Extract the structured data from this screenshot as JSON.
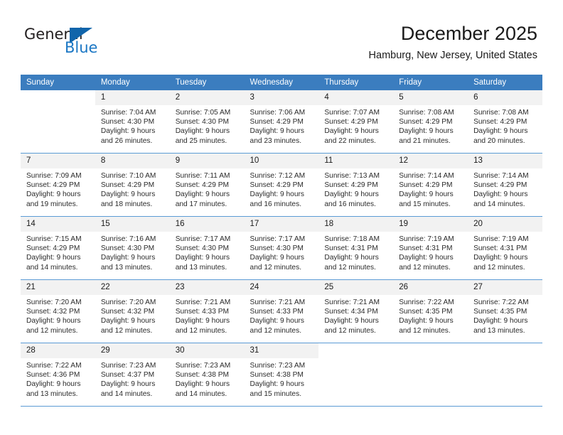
{
  "brand": {
    "name_part1": "General",
    "name_part2": "Blue",
    "triangle_icon": "triangle-icon",
    "accent_color": "#1165ab",
    "blue_text_color": "#1b77c4"
  },
  "header": {
    "title": "December 2025",
    "subtitle": "Hamburg, New Jersey, United States"
  },
  "calendar": {
    "header_bg": "#3b7dbf",
    "header_text_color": "#ffffff",
    "daynum_bg": "#f2f2f2",
    "row_separator_color": "#5b9bd5",
    "weekday_headers": [
      "Sunday",
      "Monday",
      "Tuesday",
      "Wednesday",
      "Thursday",
      "Friday",
      "Saturday"
    ],
    "weeks": [
      [
        {
          "day": "",
          "lines": []
        },
        {
          "day": "1",
          "lines": [
            "Sunrise: 7:04 AM",
            "Sunset: 4:30 PM",
            "Daylight: 9 hours",
            "and 26 minutes."
          ]
        },
        {
          "day": "2",
          "lines": [
            "Sunrise: 7:05 AM",
            "Sunset: 4:30 PM",
            "Daylight: 9 hours",
            "and 25 minutes."
          ]
        },
        {
          "day": "3",
          "lines": [
            "Sunrise: 7:06 AM",
            "Sunset: 4:29 PM",
            "Daylight: 9 hours",
            "and 23 minutes."
          ]
        },
        {
          "day": "4",
          "lines": [
            "Sunrise: 7:07 AM",
            "Sunset: 4:29 PM",
            "Daylight: 9 hours",
            "and 22 minutes."
          ]
        },
        {
          "day": "5",
          "lines": [
            "Sunrise: 7:08 AM",
            "Sunset: 4:29 PM",
            "Daylight: 9 hours",
            "and 21 minutes."
          ]
        },
        {
          "day": "6",
          "lines": [
            "Sunrise: 7:08 AM",
            "Sunset: 4:29 PM",
            "Daylight: 9 hours",
            "and 20 minutes."
          ]
        }
      ],
      [
        {
          "day": "7",
          "lines": [
            "Sunrise: 7:09 AM",
            "Sunset: 4:29 PM",
            "Daylight: 9 hours",
            "and 19 minutes."
          ]
        },
        {
          "day": "8",
          "lines": [
            "Sunrise: 7:10 AM",
            "Sunset: 4:29 PM",
            "Daylight: 9 hours",
            "and 18 minutes."
          ]
        },
        {
          "day": "9",
          "lines": [
            "Sunrise: 7:11 AM",
            "Sunset: 4:29 PM",
            "Daylight: 9 hours",
            "and 17 minutes."
          ]
        },
        {
          "day": "10",
          "lines": [
            "Sunrise: 7:12 AM",
            "Sunset: 4:29 PM",
            "Daylight: 9 hours",
            "and 16 minutes."
          ]
        },
        {
          "day": "11",
          "lines": [
            "Sunrise: 7:13 AM",
            "Sunset: 4:29 PM",
            "Daylight: 9 hours",
            "and 16 minutes."
          ]
        },
        {
          "day": "12",
          "lines": [
            "Sunrise: 7:14 AM",
            "Sunset: 4:29 PM",
            "Daylight: 9 hours",
            "and 15 minutes."
          ]
        },
        {
          "day": "13",
          "lines": [
            "Sunrise: 7:14 AM",
            "Sunset: 4:29 PM",
            "Daylight: 9 hours",
            "and 14 minutes."
          ]
        }
      ],
      [
        {
          "day": "14",
          "lines": [
            "Sunrise: 7:15 AM",
            "Sunset: 4:29 PM",
            "Daylight: 9 hours",
            "and 14 minutes."
          ]
        },
        {
          "day": "15",
          "lines": [
            "Sunrise: 7:16 AM",
            "Sunset: 4:30 PM",
            "Daylight: 9 hours",
            "and 13 minutes."
          ]
        },
        {
          "day": "16",
          "lines": [
            "Sunrise: 7:17 AM",
            "Sunset: 4:30 PM",
            "Daylight: 9 hours",
            "and 13 minutes."
          ]
        },
        {
          "day": "17",
          "lines": [
            "Sunrise: 7:17 AM",
            "Sunset: 4:30 PM",
            "Daylight: 9 hours",
            "and 12 minutes."
          ]
        },
        {
          "day": "18",
          "lines": [
            "Sunrise: 7:18 AM",
            "Sunset: 4:31 PM",
            "Daylight: 9 hours",
            "and 12 minutes."
          ]
        },
        {
          "day": "19",
          "lines": [
            "Sunrise: 7:19 AM",
            "Sunset: 4:31 PM",
            "Daylight: 9 hours",
            "and 12 minutes."
          ]
        },
        {
          "day": "20",
          "lines": [
            "Sunrise: 7:19 AM",
            "Sunset: 4:31 PM",
            "Daylight: 9 hours",
            "and 12 minutes."
          ]
        }
      ],
      [
        {
          "day": "21",
          "lines": [
            "Sunrise: 7:20 AM",
            "Sunset: 4:32 PM",
            "Daylight: 9 hours",
            "and 12 minutes."
          ]
        },
        {
          "day": "22",
          "lines": [
            "Sunrise: 7:20 AM",
            "Sunset: 4:32 PM",
            "Daylight: 9 hours",
            "and 12 minutes."
          ]
        },
        {
          "day": "23",
          "lines": [
            "Sunrise: 7:21 AM",
            "Sunset: 4:33 PM",
            "Daylight: 9 hours",
            "and 12 minutes."
          ]
        },
        {
          "day": "24",
          "lines": [
            "Sunrise: 7:21 AM",
            "Sunset: 4:33 PM",
            "Daylight: 9 hours",
            "and 12 minutes."
          ]
        },
        {
          "day": "25",
          "lines": [
            "Sunrise: 7:21 AM",
            "Sunset: 4:34 PM",
            "Daylight: 9 hours",
            "and 12 minutes."
          ]
        },
        {
          "day": "26",
          "lines": [
            "Sunrise: 7:22 AM",
            "Sunset: 4:35 PM",
            "Daylight: 9 hours",
            "and 12 minutes."
          ]
        },
        {
          "day": "27",
          "lines": [
            "Sunrise: 7:22 AM",
            "Sunset: 4:35 PM",
            "Daylight: 9 hours",
            "and 13 minutes."
          ]
        }
      ],
      [
        {
          "day": "28",
          "lines": [
            "Sunrise: 7:22 AM",
            "Sunset: 4:36 PM",
            "Daylight: 9 hours",
            "and 13 minutes."
          ]
        },
        {
          "day": "29",
          "lines": [
            "Sunrise: 7:23 AM",
            "Sunset: 4:37 PM",
            "Daylight: 9 hours",
            "and 14 minutes."
          ]
        },
        {
          "day": "30",
          "lines": [
            "Sunrise: 7:23 AM",
            "Sunset: 4:38 PM",
            "Daylight: 9 hours",
            "and 14 minutes."
          ]
        },
        {
          "day": "31",
          "lines": [
            "Sunrise: 7:23 AM",
            "Sunset: 4:38 PM",
            "Daylight: 9 hours",
            "and 15 minutes."
          ]
        },
        {
          "day": "",
          "lines": []
        },
        {
          "day": "",
          "lines": []
        },
        {
          "day": "",
          "lines": []
        }
      ]
    ]
  }
}
